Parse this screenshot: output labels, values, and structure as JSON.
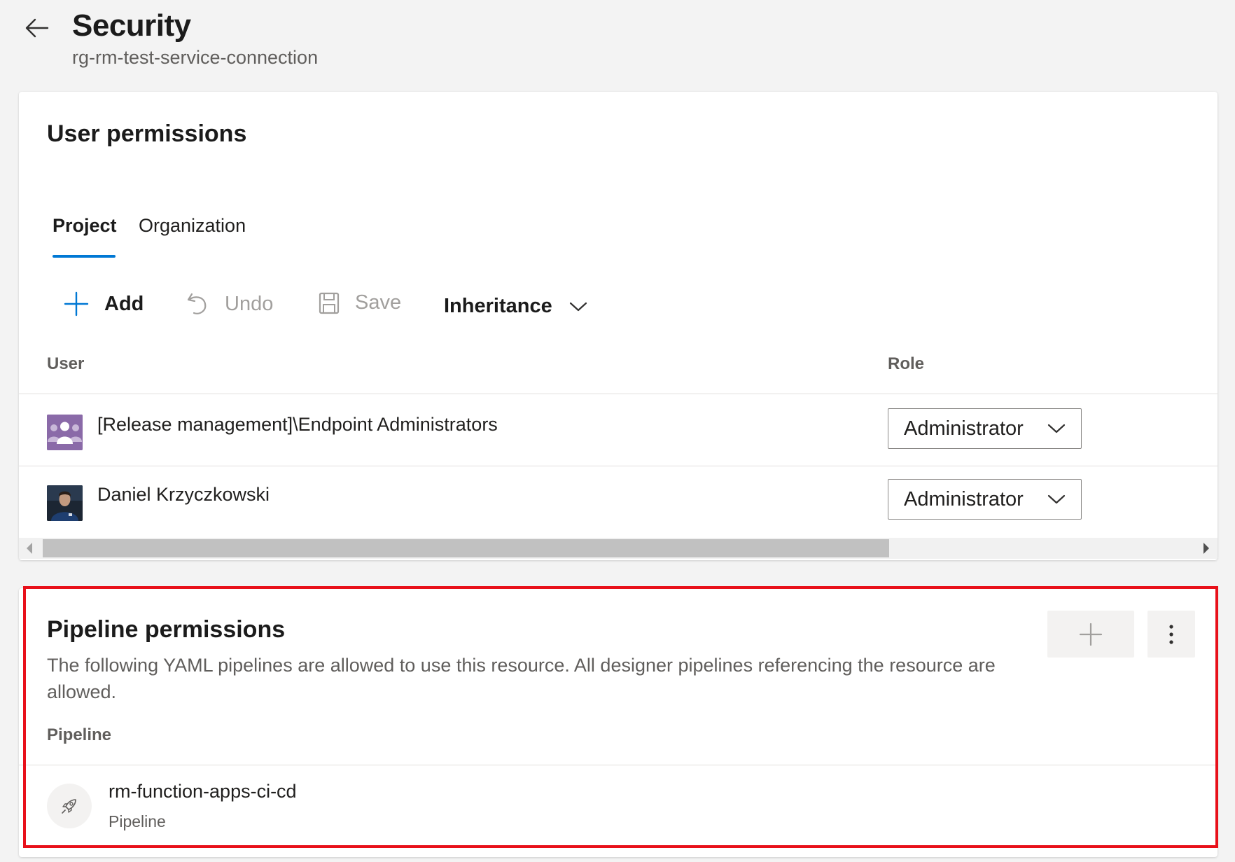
{
  "header": {
    "title": "Security",
    "subtitle": "rg-rm-test-service-connection"
  },
  "user_permissions": {
    "title": "User permissions",
    "tabs": [
      {
        "label": "Project",
        "active": true
      },
      {
        "label": "Organization",
        "active": false
      }
    ],
    "toolbar": {
      "add_label": "Add",
      "undo_label": "Undo",
      "save_label": "Save",
      "inheritance_label": "Inheritance"
    },
    "columns": {
      "user": "User",
      "role": "Role"
    },
    "rows": [
      {
        "user": "[Release management]\\Endpoint Administrators",
        "role": "Administrator",
        "avatar": "group-icon"
      },
      {
        "user": "Daniel Krzyczkowski",
        "role": "Administrator",
        "avatar": "person-photo"
      }
    ]
  },
  "pipeline_permissions": {
    "title": "Pipeline permissions",
    "description": "The following YAML pipelines are allowed to use this resource. All designer pipelines referencing the resource are allowed.",
    "column": "Pipeline",
    "items": [
      {
        "name": "rm-function-apps-ci-cd",
        "type": "Pipeline",
        "icon": "rocket-icon"
      }
    ]
  },
  "colors": {
    "accent": "#0078d4",
    "highlight": "#e8101a",
    "group_avatar": "#8a6aa8"
  }
}
